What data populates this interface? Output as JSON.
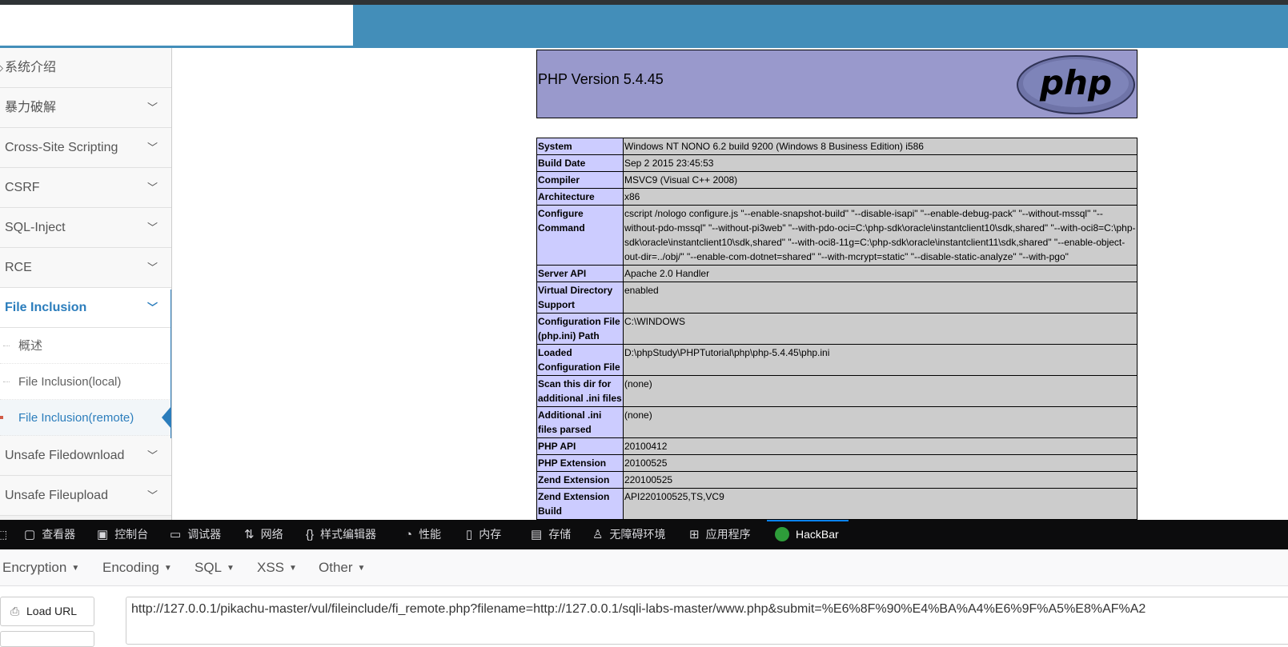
{
  "sidebar": {
    "items": [
      {
        "label": "系统介绍"
      },
      {
        "label": "暴力破解"
      },
      {
        "label": "Cross-Site Scripting"
      },
      {
        "label": "CSRF"
      },
      {
        "label": "SQL-Inject"
      },
      {
        "label": "RCE"
      },
      {
        "label": "File Inclusion"
      },
      {
        "label": "Unsafe Filedownload"
      },
      {
        "label": "Unsafe Fileupload"
      }
    ],
    "sub_items": [
      {
        "label": "概述"
      },
      {
        "label": "File Inclusion(local)"
      },
      {
        "label": "File Inclusion(remote)"
      }
    ]
  },
  "phpinfo": {
    "version": "PHP Version 5.4.45",
    "logo_text": "php",
    "rows": [
      {
        "key": "System",
        "value": "Windows NT NONO 6.2 build 9200 (Windows 8 Business Edition) i586"
      },
      {
        "key": "Build Date",
        "value": "Sep 2 2015 23:45:53"
      },
      {
        "key": "Compiler",
        "value": "MSVC9 (Visual C++ 2008)"
      },
      {
        "key": "Architecture",
        "value": "x86"
      },
      {
        "key": "Configure Command",
        "value": "cscript /nologo configure.js \"--enable-snapshot-build\" \"--disable-isapi\" \"--enable-debug-pack\" \"--without-mssql\" \"--without-pdo-mssql\" \"--without-pi3web\" \"--with-pdo-oci=C:\\php-sdk\\oracle\\instantclient10\\sdk,shared\" \"--with-oci8=C:\\php-sdk\\oracle\\instantclient10\\sdk,shared\" \"--with-oci8-11g=C:\\php-sdk\\oracle\\instantclient11\\sdk,shared\" \"--enable-object-out-dir=../obj/\" \"--enable-com-dotnet=shared\" \"--with-mcrypt=static\" \"--disable-static-analyze\" \"--with-pgo\""
      },
      {
        "key": "Server API",
        "value": "Apache 2.0 Handler"
      },
      {
        "key": "Virtual Directory Support",
        "value": "enabled"
      },
      {
        "key": "Configuration File (php.ini) Path",
        "value": "C:\\WINDOWS"
      },
      {
        "key": "Loaded Configuration File",
        "value": "D:\\phpStudy\\PHPTutorial\\php\\php-5.4.45\\php.ini"
      },
      {
        "key": "Scan this dir for additional .ini files",
        "value": "(none)"
      },
      {
        "key": "Additional .ini files parsed",
        "value": "(none)"
      },
      {
        "key": "PHP API",
        "value": "20100412"
      },
      {
        "key": "PHP Extension",
        "value": "20100525"
      },
      {
        "key": "Zend Extension",
        "value": "220100525"
      },
      {
        "key": "Zend Extension Build",
        "value": "API220100525,TS,VC9"
      }
    ]
  },
  "devtools": {
    "tabs": [
      {
        "label": "查看器",
        "icon": "inspector-icon"
      },
      {
        "label": "控制台",
        "icon": "console-icon"
      },
      {
        "label": "调试器",
        "icon": "debugger-icon"
      },
      {
        "label": "网络",
        "icon": "network-icon"
      },
      {
        "label": "样式编辑器",
        "icon": "style-editor-icon"
      },
      {
        "label": "性能",
        "icon": "performance-icon"
      },
      {
        "label": "内存",
        "icon": "memory-icon"
      },
      {
        "label": "存储",
        "icon": "storage-icon"
      },
      {
        "label": "无障碍环境",
        "icon": "accessibility-icon"
      },
      {
        "label": "应用程序",
        "icon": "application-icon"
      },
      {
        "label": "HackBar",
        "icon": "hackbar-icon"
      }
    ]
  },
  "hackbar": {
    "menus": [
      {
        "label": "Encryption"
      },
      {
        "label": "Encoding"
      },
      {
        "label": "SQL"
      },
      {
        "label": "XSS"
      },
      {
        "label": "Other"
      }
    ],
    "load_url_label": "Load URL",
    "url_value": "http://127.0.0.1/pikachu-master/vul/fileinclude/fi_remote.php?filename=http://127.0.0.1/sqli-labs-master/www.php&submit=%E6%8F%90%E4%BA%A4%E6%9F%A5%E8%AF%A2"
  },
  "colors": {
    "topbar": "#438eb9",
    "accent": "#2b7dbc",
    "php_header": "#9999cc",
    "php_key": "#ccccff",
    "php_value": "#cccccc",
    "devtools_bg": "#0c0c0d"
  }
}
